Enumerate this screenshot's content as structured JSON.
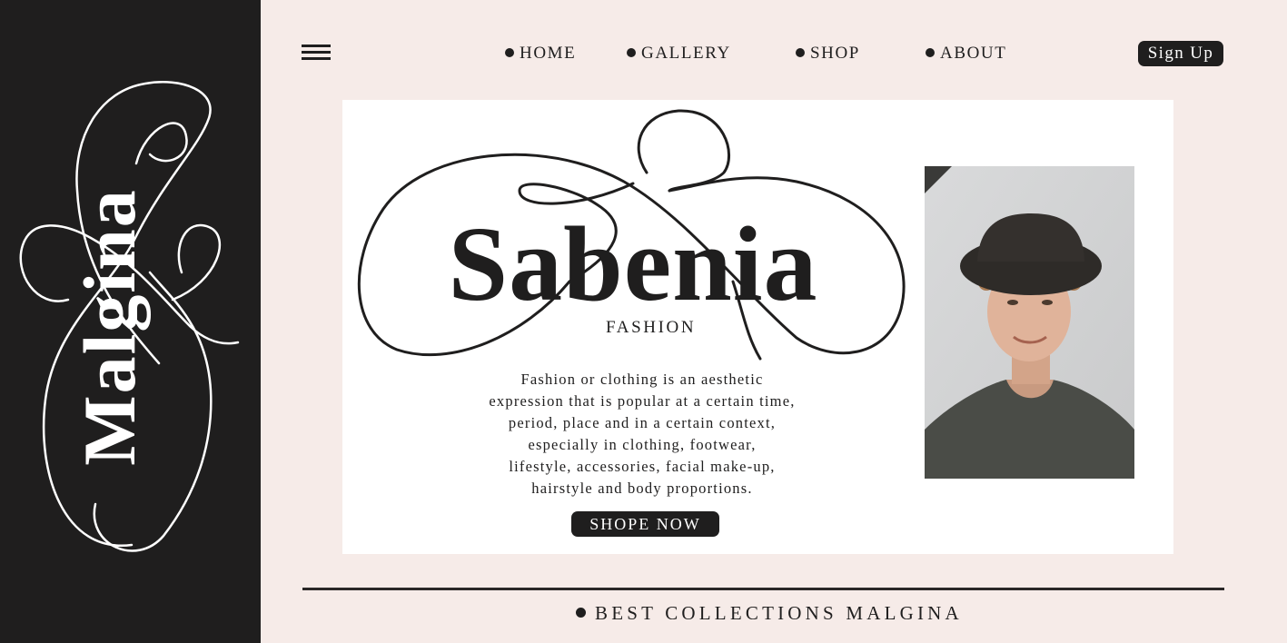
{
  "sidebar": {
    "logo_text": "Malgina",
    "background": "#1f1e1e"
  },
  "header": {
    "menu_icon": "hamburger-menu-icon",
    "nav": [
      {
        "label": "HOME"
      },
      {
        "label": "GALLERY"
      },
      {
        "label": "SHOP"
      },
      {
        "label": "ABOUT"
      }
    ],
    "signup_label": "Sign Up"
  },
  "hero": {
    "brand_name": "Sabenia",
    "brand_subtitle": "FASHION",
    "description_lines": [
      "Fashion or clothing is an aesthetic",
      "expression that is popular at a certain time,",
      "period, place and in a certain context,",
      "especially in clothing, footwear,",
      "lifestyle, accessories, facial make-up,",
      "hairstyle and body proportions."
    ],
    "cta_label": "SHOPE NOW"
  },
  "footer": {
    "collections_label": "BEST COLLECTIONS MALGINA"
  },
  "colors": {
    "page_background": "#f6ebe8",
    "dark": "#1f1e1e",
    "card": "#ffffff"
  }
}
